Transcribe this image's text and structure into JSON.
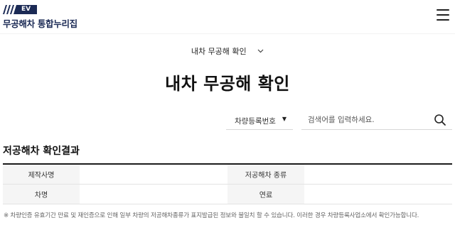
{
  "header": {
    "logo_badge": "EV",
    "logo_text": "무공해차 통합누리집",
    "menu_icon": "hamburger-menu-icon"
  },
  "page_selector": {
    "label": "내차 무공해 확인",
    "icon": "chevron-down-icon"
  },
  "page_title": "내차 무공해 확인",
  "search": {
    "type_selected": "차량등록번호",
    "placeholder": "검색어를 입력하세요.",
    "icon": "search-icon"
  },
  "results": {
    "title": "저공해차 확인결과",
    "rows": [
      {
        "label1": "제작사명",
        "value1": "",
        "label2": "저공해차 종류",
        "value2": ""
      },
      {
        "label1": "차명",
        "value1": "",
        "label2": "연료",
        "value2": ""
      }
    ]
  },
  "notice": "※ 차량인증 유효기간 만료 및 재인증으로 인해 일부 차량의 저공해차종류가 표지발급된 정보와 불일치 할 수 있습니다. 이러한 경우 차량등록사업소에서 확인가능합니다.",
  "colors": {
    "logo_navy": "#1b2a55",
    "table_border": "#1c1c1c",
    "header_cell_bg": "#f5f5f5"
  }
}
